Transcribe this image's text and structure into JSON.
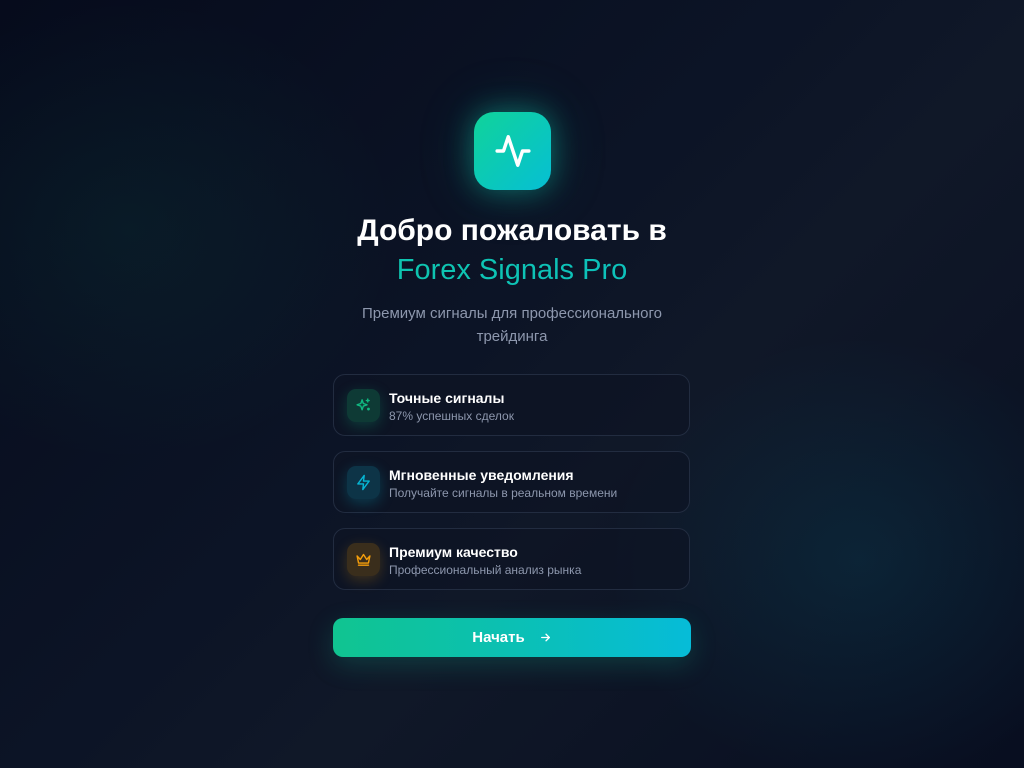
{
  "logo": {
    "icon": "activity-pulse-icon",
    "gradient": [
      "#10d39a",
      "#06bfd4"
    ]
  },
  "header": {
    "title_line1": "Добро пожаловать в",
    "title_line2": "Forex Signals Pro",
    "subtitle": "Премиум сигналы для профессионального трейдинга"
  },
  "features": [
    {
      "icon": "sparkles-icon",
      "color": "#10b981",
      "title": "Точные сигналы",
      "description": "87% успешных сделок"
    },
    {
      "icon": "lightning-icon",
      "color": "#06b6d4",
      "title": "Мгновенные уведомления",
      "description": "Получайте сигналы в реальном времени"
    },
    {
      "icon": "crown-icon",
      "color": "#f59e0b",
      "title": "Премиум качество",
      "description": "Профессиональный анализ рынка"
    }
  ],
  "start_button": {
    "label": "Начать",
    "icon": "arrow-right-icon"
  },
  "colors": {
    "accent_green": "#10b981",
    "accent_cyan": "#06b6d4",
    "accent_amber": "#f59e0b",
    "background": "#0b1222"
  }
}
